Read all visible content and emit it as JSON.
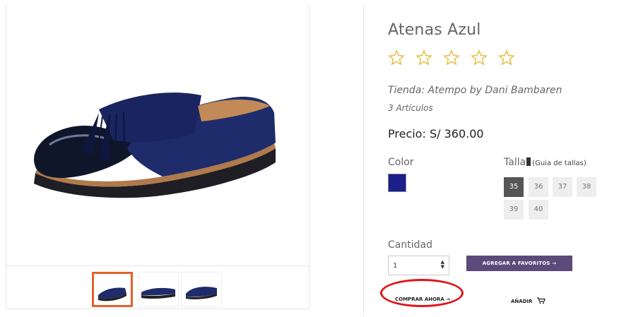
{
  "product": {
    "title": "Atenas Azul",
    "rating_stars": 5,
    "rating_value": 0,
    "store": "Tienda: Atempo by Dani Bambaren",
    "articles": "3 Artículos",
    "price": "Precio: S/ 360.00"
  },
  "color": {
    "label": "Color",
    "swatch": "#1a1f8a"
  },
  "size": {
    "label": "Talla",
    "guide": "(Guia de tallas)",
    "options": [
      "35",
      "36",
      "37",
      "38",
      "39",
      "40"
    ],
    "selected": "35"
  },
  "quantity": {
    "label": "Cantidad",
    "value": "1"
  },
  "actions": {
    "favorites": "AGREGAR A FAVORITOS →",
    "buy_now": "COMPRAR AHORA →",
    "add": "AÑADIR"
  },
  "gallery": {
    "selected_index": 0,
    "thumbnails": [
      "shoe-front-view",
      "shoe-side-view",
      "shoe-angle-view"
    ]
  },
  "colors": {
    "accent_purple": "#5b4a7a",
    "thumb_highlight": "#e4622a",
    "annotation_red": "#e0141b",
    "star_yellow": "#e8c24a"
  }
}
